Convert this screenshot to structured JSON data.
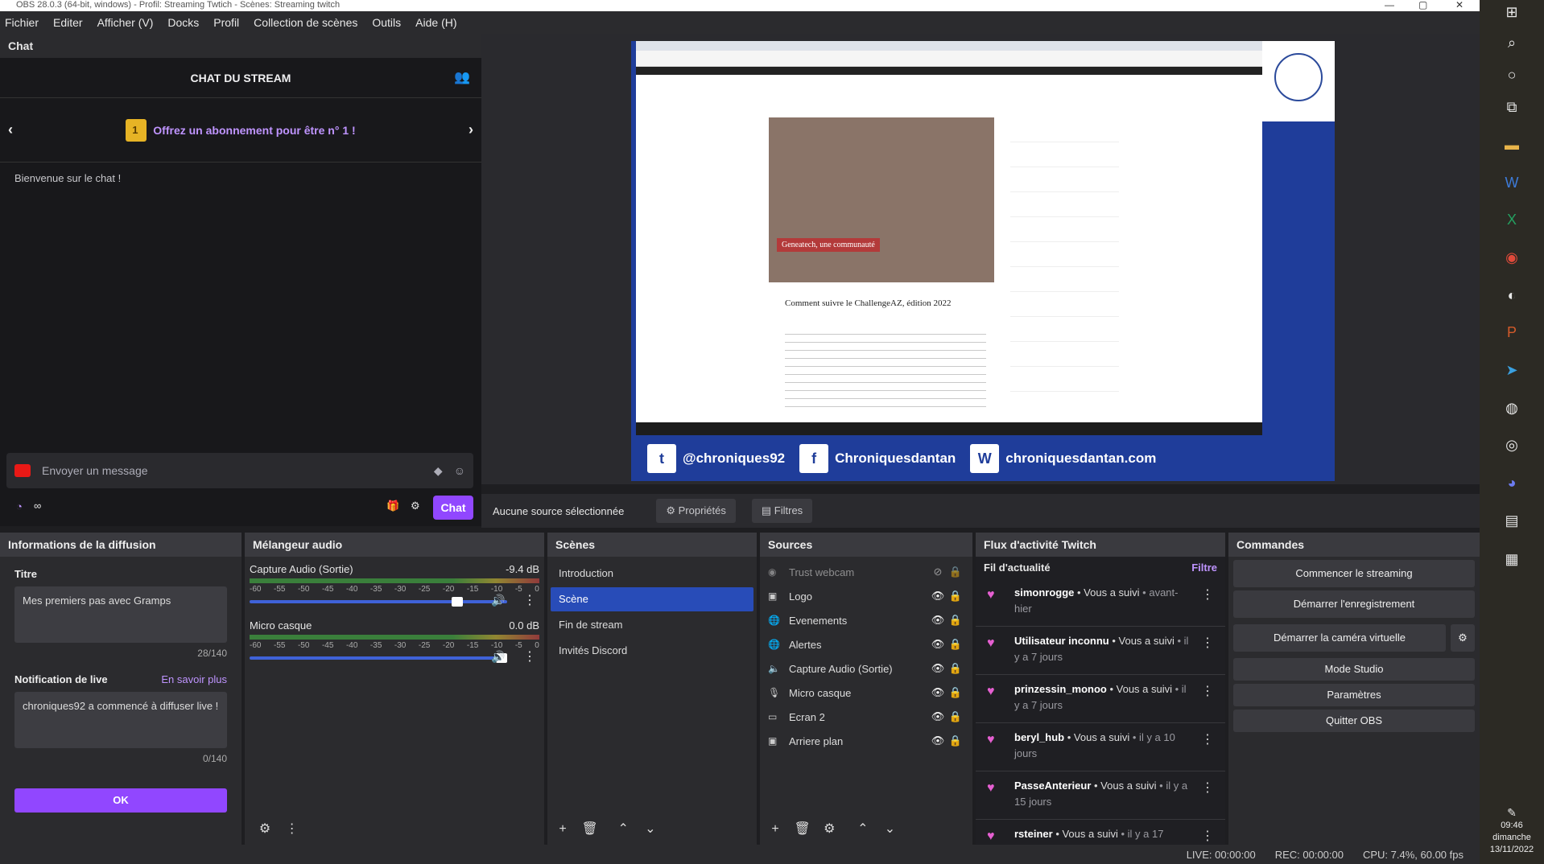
{
  "window": {
    "title": "OBS 28.0.3 (64-bit, windows) - Profil: Streaming Twtich - Scènes: Streaming twitch"
  },
  "menu": [
    "Fichier",
    "Editer",
    "Afficher (V)",
    "Docks",
    "Profil",
    "Collection de scènes",
    "Outils",
    "Aide (H)"
  ],
  "chat": {
    "dock_title": "Chat",
    "header": "CHAT DU STREAM",
    "sub_banner": "Offrez un abonnement pour être n° 1 !",
    "welcome": "Bienvenue sur le chat !",
    "input_placeholder": "Envoyer un message",
    "timer": "∞",
    "send_label": "Chat"
  },
  "preview": {
    "social": [
      "@chroniques92",
      "Chroniquesdantan",
      "chroniquesdantan.com"
    ],
    "site_headline": "Comment suivre le ChallengeAZ, édition 2022",
    "site_caption": "Geneatech, une communauté"
  },
  "props": {
    "no_source": "Aucune source sélectionnée",
    "properties": "Propriétés",
    "filters": "Filtres"
  },
  "info": {
    "title": "Informations de la diffusion",
    "titre_label": "Titre",
    "titre_value": "Mes premiers pas avec Gramps",
    "titre_count": "28/140",
    "notif_label": "Notification de live",
    "learn_more": "En savoir plus",
    "notif_value": "chroniques92 a commencé à diffuser live !",
    "notif_count": "0/140",
    "ok": "OK"
  },
  "mixer": {
    "title": "Mélangeur audio",
    "tracks": [
      {
        "name": "Capture Audio (Sortie)",
        "db": "-9.4 dB",
        "level": 0.82
      },
      {
        "name": "Micro casque",
        "db": "0.0 dB",
        "level": 1.0
      }
    ],
    "ticks": [
      "-60",
      "-55",
      "-50",
      "-45",
      "-40",
      "-35",
      "-30",
      "-25",
      "-20",
      "-15",
      "-10",
      "-5",
      "0"
    ]
  },
  "scenes": {
    "title": "Scènes",
    "items": [
      "Introduction",
      "Scène",
      "Fin de stream",
      "Invités Discord"
    ],
    "selected": 1
  },
  "sources": {
    "title": "Sources",
    "items": [
      "Trust webcam",
      "Logo",
      "Evenements",
      "Alertes",
      "Capture Audio (Sortie)",
      "Micro casque",
      "Ecran 2",
      "Arriere plan"
    ]
  },
  "flux": {
    "title": "Flux d'activité Twitch",
    "sub": "Fil d'actualité",
    "filter": "Filtre",
    "items": [
      {
        "user": "simonrogge",
        "action": " • Vous a suivi",
        "time": " • avant-hier"
      },
      {
        "user": "Utilisateur inconnu",
        "action": " • Vous a suivi",
        "time": " • il y a 7 jours"
      },
      {
        "user": "prinzessin_monoo",
        "action": " • Vous a suivi",
        "time": " • il y a 7 jours"
      },
      {
        "user": "beryl_hub",
        "action": " • Vous a suivi",
        "time": " • il y a 10 jours"
      },
      {
        "user": "PasseAnterieur",
        "action": " • Vous a suivi",
        "time": " • il y a 15 jours"
      },
      {
        "user": "rsteiner",
        "action": " • Vous a suivi",
        "time": " • il y a 17"
      }
    ]
  },
  "commands": {
    "title": "Commandes",
    "buttons": [
      "Commencer le streaming",
      "Démarrer l'enregistrement",
      "Démarrer la caméra virtuelle",
      "Mode Studio",
      "Paramètres",
      "Quitter OBS"
    ]
  },
  "status": {
    "live": "LIVE: 00:00:00",
    "rec": "REC: 00:00:00",
    "cpu": "CPU: 7.4%, 60.00 fps"
  },
  "clock": {
    "time": "09:46",
    "day": "dimanche",
    "date": "13/11/2022"
  }
}
